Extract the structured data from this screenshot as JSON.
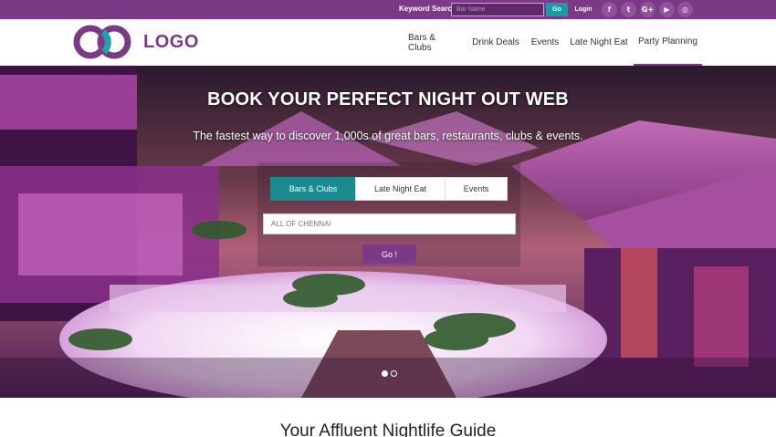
{
  "topbar": {
    "keyword_label": "Keyword Search",
    "search_placeholder": "Bar Name",
    "go_label": "Go",
    "login_label": "Login",
    "social": [
      {
        "icon": "facebook-icon",
        "glyph": "f"
      },
      {
        "icon": "twitter-icon",
        "glyph": "t"
      },
      {
        "icon": "google-plus-icon",
        "glyph": "G+"
      },
      {
        "icon": "youtube-icon",
        "glyph": "▶"
      },
      {
        "icon": "instagram-icon",
        "glyph": "◎"
      }
    ]
  },
  "header": {
    "logo_text": "LOGO",
    "nav": [
      {
        "label": "Bars & Clubs"
      },
      {
        "label": "Drink Deals"
      },
      {
        "label": "Events"
      },
      {
        "label": "Late Night Eat"
      },
      {
        "label": "Party Planning",
        "active": true
      }
    ]
  },
  "hero": {
    "title": "BOOK YOUR PERFECT NIGHT OUT WEB",
    "subtitle": "The fastest way to discover 1,000s of great bars, restaurants, clubs & events.",
    "tabs": [
      {
        "label": "Bars & Clubs",
        "active": true
      },
      {
        "label": "Late Night Eat"
      },
      {
        "label": "Events"
      }
    ],
    "city_placeholder": "ALL OF CHENNAI",
    "go_label": "Go !"
  },
  "section": {
    "heading": "Your Affluent Nightlife Guide"
  },
  "colors": {
    "brand": "#7b3a86",
    "accent_teal": "#1a8a8f"
  }
}
